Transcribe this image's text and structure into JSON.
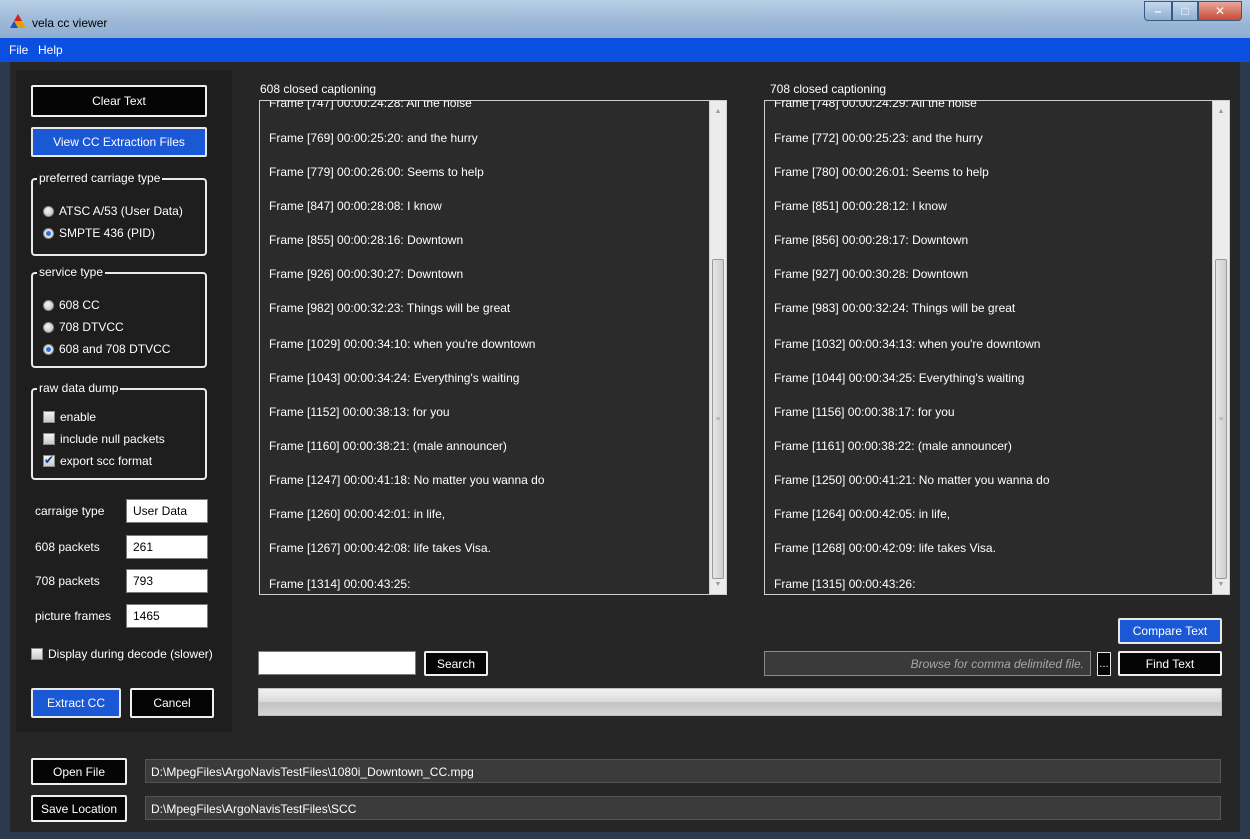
{
  "window": {
    "title": "vela cc viewer",
    "buttons": {
      "minimize": "–",
      "maximize": "□",
      "close": "✕"
    }
  },
  "menu": {
    "items": [
      "File",
      "Help"
    ]
  },
  "left_panel": {
    "clear_text": "Clear Text",
    "view_cc_files": "View CC Extraction Files",
    "carriage_group": {
      "label": "preferred carriage type",
      "options": [
        {
          "label": "ATSC A/53 (User Data)",
          "selected": false
        },
        {
          "label": "SMPTE 436 (PID)",
          "selected": true
        }
      ]
    },
    "service_group": {
      "label": "service type",
      "options": [
        {
          "label": "608 CC",
          "selected": false
        },
        {
          "label": "708 DTVCC",
          "selected": false
        },
        {
          "label": "608 and 708 DTVCC",
          "selected": true
        }
      ]
    },
    "raw_dump_group": {
      "label": "raw data dump",
      "options": [
        {
          "label": "enable",
          "checked": false
        },
        {
          "label": "include null packets",
          "checked": false
        },
        {
          "label": "export scc format",
          "checked": true
        }
      ]
    },
    "fields": {
      "carraige_type": {
        "label": "carraige type",
        "value": "User Data"
      },
      "packets_608": {
        "label": "608 packets",
        "value": "261"
      },
      "packets_708": {
        "label": "708 packets",
        "value": "793"
      },
      "picture_frames": {
        "label": "picture frames",
        "value": "1465"
      }
    },
    "display_during_decode": {
      "label": "Display during decode (slower)",
      "checked": false
    },
    "extract_cc": "Extract CC",
    "cancel": "Cancel"
  },
  "caption_608": {
    "title": "608 closed captioning",
    "partial_top": "Frame [747] 00:00:24:28:  All the noise",
    "lines": [
      "Frame [769] 00:00:25:20: and the hurry",
      "Frame [779] 00:00:26:00:  Seems to help",
      "Frame [847] 00:00:28:08: I know",
      "Frame [855] 00:00:28:16:  Downtown",
      "Frame [926] 00:00:30:27:  Downtown",
      "Frame [982] 00:00:32:23:  Things will be great",
      "Frame [1029] 00:00:34:10: when you're downtown",
      "Frame [1043] 00:00:34:24:  Everything's waiting",
      "Frame [1152] 00:00:38:13: for you",
      "Frame [1160] 00:00:38:21: (male announcer)",
      "Frame [1247] 00:00:41:18: No matter you wanna do",
      "Frame [1260] 00:00:42:01: in life,",
      "Frame [1267] 00:00:42:08: life takes Visa.",
      "Frame [1314] 00:00:43:25:"
    ]
  },
  "caption_708": {
    "title": "708 closed captioning",
    "partial_top": "Frame [748] 00:00:24:29:  All the noise",
    "lines": [
      "Frame [772] 00:00:25:23: and the hurry",
      "Frame [780] 00:00:26:01:  Seems to help",
      "Frame [851] 00:00:28:12: I know",
      "Frame [856] 00:00:28:17:  Downtown",
      "Frame [927] 00:00:30:28:  Downtown",
      "Frame [983] 00:00:32:24:  Things will be great",
      "Frame [1032] 00:00:34:13: when you're downtown",
      "Frame [1044] 00:00:34:25:  Everything's waiting",
      "Frame [1156] 00:00:38:17: for you",
      "Frame [1161] 00:00:38:22: (male announcer)",
      "Frame [1250] 00:00:41:21: No matter you wanna do",
      "Frame [1264] 00:00:42:05: in life,",
      "Frame [1268] 00:00:42:09: life takes Visa.",
      "Frame [1315] 00:00:43:26:"
    ]
  },
  "search": {
    "value": "",
    "button": "Search"
  },
  "compare_text": "Compare Text",
  "find": {
    "placeholder": "Browse for comma delimited file.",
    "browse_button": "...",
    "button": "Find Text"
  },
  "progress": {
    "fraction": 0.0
  },
  "bottom": {
    "open_file": "Open File",
    "open_path": "D:\\MpegFiles\\ArgoNavisTestFiles\\1080i_Downtown_CC.mpg",
    "save_location": "Save Location",
    "save_path": "D:\\MpegFiles\\ArgoNavisTestFiles\\SCC"
  },
  "colors": {
    "accent_blue": "#1a58d6",
    "menu_blue": "#0b4fe0",
    "panel_dark": "#1e1e1e",
    "progress_green": "#46bd41"
  }
}
